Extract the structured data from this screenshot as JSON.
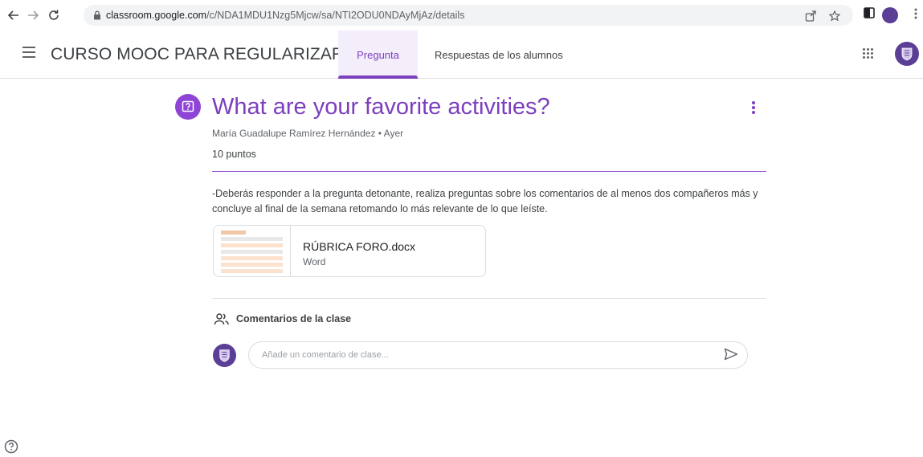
{
  "browser": {
    "url_host": "classroom.google.com",
    "url_path": "/c/NDA1MDU1Nzg5Mjcw/sa/NTI2ODU0NDAyMjAz/details"
  },
  "appbar": {
    "course_title": "CURSO MOOC PARA REGULARIZAR ...",
    "tabs": [
      {
        "label": "Pregunta",
        "active": true
      },
      {
        "label": "Respuestas de los alumnos",
        "active": false
      }
    ]
  },
  "question": {
    "title": "What are your favorite activities?",
    "author": "María Guadalupe Ramírez Hernández",
    "date": "Ayer",
    "points": "10 puntos",
    "description": "-Deberás responder a la pregunta detonante, realiza preguntas sobre los comentarios de al menos dos compañeros más y concluye al final de la semana retomando lo más relevante de lo que leíste."
  },
  "attachment": {
    "name": "RÚBRICA FORO.docx",
    "type": "Word"
  },
  "comments": {
    "label": "Comentarios de la clase",
    "placeholder": "Añade un comentario de clase..."
  },
  "colors": {
    "accent": "#7b3fbe",
    "icon_bg": "#8e44d6",
    "avatar": "#5b3e96"
  }
}
